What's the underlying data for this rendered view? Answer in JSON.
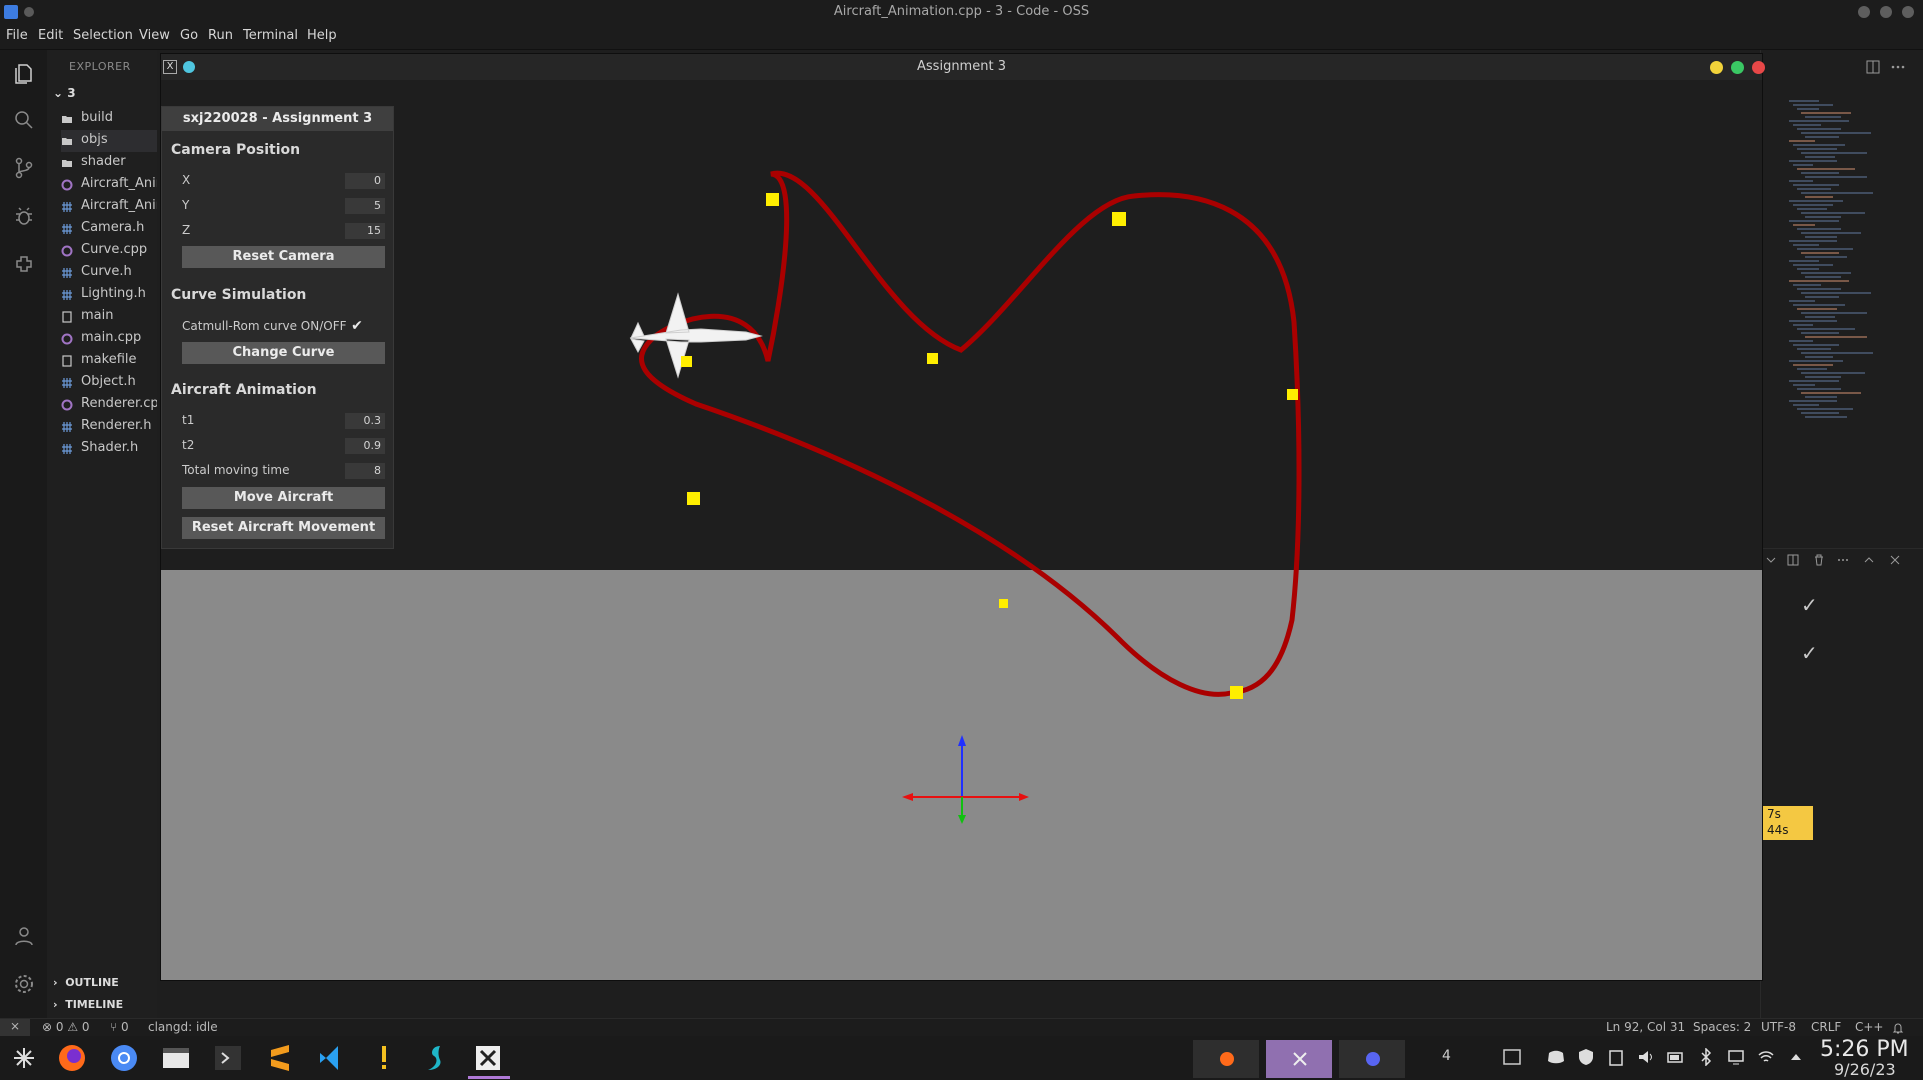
{
  "window": {
    "title": "Aircraft_Animation.cpp - 3 - Code - OSS"
  },
  "menu": [
    "File",
    "Edit",
    "Selection",
    "View",
    "Go",
    "Run",
    "Terminal",
    "Help"
  ],
  "explorer": {
    "header": "EXPLORER",
    "root": "3",
    "items": [
      {
        "label": "build",
        "icon": "folder-icon"
      },
      {
        "label": "objs",
        "icon": "folder-icon"
      },
      {
        "label": "shader",
        "icon": "folder-icon"
      },
      {
        "label": "Aircraft_Anir",
        "icon": "cpp-file-icon"
      },
      {
        "label": "Aircraft_Anir",
        "icon": "header-file-icon"
      },
      {
        "label": "Camera.h",
        "icon": "header-file-icon"
      },
      {
        "label": "Curve.cpp",
        "icon": "cpp-file-icon"
      },
      {
        "label": "Curve.h",
        "icon": "header-file-icon"
      },
      {
        "label": "Lighting.h",
        "icon": "header-file-icon"
      },
      {
        "label": "main",
        "icon": "file-icon"
      },
      {
        "label": "main.cpp",
        "icon": "cpp-file-icon"
      },
      {
        "label": "makefile",
        "icon": "makefile-icon"
      },
      {
        "label": "Object.h",
        "icon": "header-file-icon"
      },
      {
        "label": "Renderer.cpp",
        "icon": "cpp-file-icon"
      },
      {
        "label": "Renderer.h",
        "icon": "header-file-icon"
      },
      {
        "label": "Shader.h",
        "icon": "header-file-icon"
      }
    ],
    "outline": "OUTLINE",
    "timeline": "TIMELINE"
  },
  "glwindow": {
    "title": "Assignment 3",
    "x_icon": "X"
  },
  "imgui": {
    "title": "sxj220028 - Assignment 3",
    "camera": {
      "heading": "Camera Position",
      "x_label": "X",
      "x_value": "0",
      "y_label": "Y",
      "y_value": "5",
      "z_label": "Z",
      "z_value": "15",
      "reset_label": "Reset Camera"
    },
    "curve": {
      "heading": "Curve Simulation",
      "toggle_label": "Catmull-Rom curve ON/OFF",
      "toggle_on": true,
      "change_label": "Change Curve"
    },
    "aircraft": {
      "heading": "Aircraft Animation",
      "t1_label": "t1",
      "t1_value": "0.3",
      "t2_label": "t2",
      "t2_value": "0.9",
      "time_label": "Total moving time",
      "time_value": "8",
      "move_label": "Move Aircraft",
      "reset_label": "Reset Aircraft Movement"
    }
  },
  "panel_right": {
    "check_mark": "✓",
    "timer_line1": "7s",
    "timer_line2": "44s"
  },
  "statusbar": {
    "remote": "⨯",
    "problems": "⊗ 0 ⚠ 0",
    "ports": "⑂ 0",
    "clangd": "clangd: idle",
    "position": "Ln 92, Col 31",
    "spaces": "Spaces: 2",
    "encoding": "UTF-8",
    "eol": "CRLF",
    "language": "C++"
  },
  "taskbar": {
    "workspace": "4",
    "time": "5:26 PM",
    "date": "9/26/23"
  },
  "colors": {
    "curve": "#aa0000",
    "control_point": "#ffee00",
    "sky": "#1e1e1e",
    "ground": "#8a8a8a"
  }
}
